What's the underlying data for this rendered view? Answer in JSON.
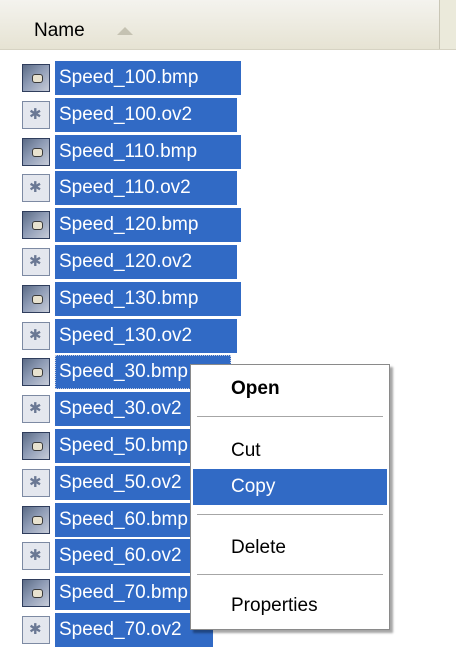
{
  "header": {
    "column_name": "Name"
  },
  "files": [
    {
      "name": "Speed_100.bmp",
      "type": "bmp"
    },
    {
      "name": "Speed_100.ov2",
      "type": "ov2"
    },
    {
      "name": "Speed_110.bmp",
      "type": "bmp"
    },
    {
      "name": "Speed_110.ov2",
      "type": "ov2"
    },
    {
      "name": "Speed_120.bmp",
      "type": "bmp"
    },
    {
      "name": "Speed_120.ov2",
      "type": "ov2"
    },
    {
      "name": "Speed_130.bmp",
      "type": "bmp"
    },
    {
      "name": "Speed_130.ov2",
      "type": "ov2"
    },
    {
      "name": "Speed_30.bmp",
      "type": "bmp"
    },
    {
      "name": "Speed_30.ov2",
      "type": "ov2"
    },
    {
      "name": "Speed_50.bmp",
      "type": "bmp"
    },
    {
      "name": "Speed_50.ov2",
      "type": "ov2"
    },
    {
      "name": "Speed_60.bmp",
      "type": "bmp"
    },
    {
      "name": "Speed_60.ov2",
      "type": "ov2"
    },
    {
      "name": "Speed_70.bmp",
      "type": "bmp"
    },
    {
      "name": "Speed_70.ov2",
      "type": "ov2"
    }
  ],
  "context_menu": {
    "open": "Open",
    "cut": "Cut",
    "copy": "Copy",
    "delete": "Delete",
    "properties": "Properties"
  },
  "colors": {
    "selection": "#316ac5",
    "header_background": "#ebeadb"
  },
  "icons": {
    "bmp": "bitmap-file-icon",
    "ov2": "ov2-file-icon",
    "sort": "sort-ascending-icon"
  }
}
